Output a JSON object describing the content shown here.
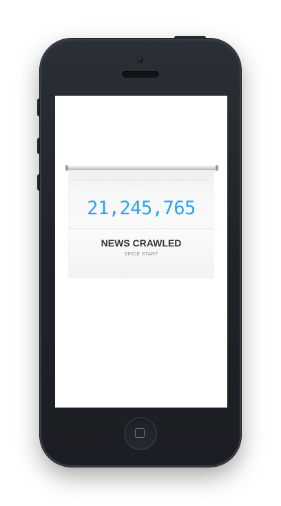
{
  "device": {
    "model": "smartphone",
    "body_color": "#1f2329",
    "icons": {
      "camera": "camera-icon",
      "speaker": "speaker-grille",
      "home": "home-square-icon"
    }
  },
  "widget": {
    "counter_value": "21,245,765",
    "title": "NEWS CRAWLED",
    "subtitle": "SINCE START",
    "colors": {
      "counter": "#2aa3e8",
      "title": "#333333",
      "subtitle": "#8c8c8c",
      "paper": "#f7f7f7",
      "rule": "#f1c9c9"
    }
  }
}
